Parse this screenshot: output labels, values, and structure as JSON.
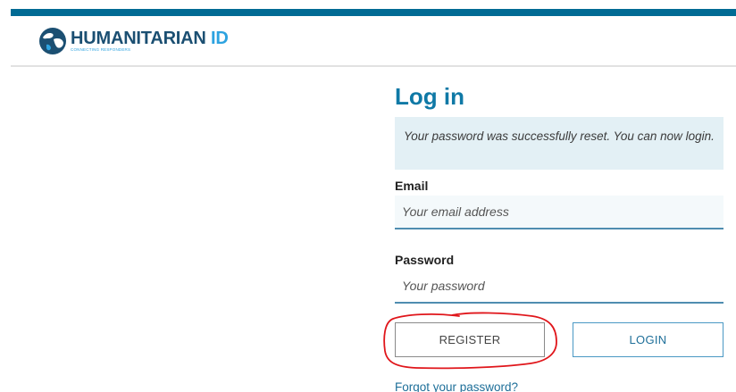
{
  "header": {
    "logo_title": "HUMANITARIAN",
    "logo_title_accent": "ID",
    "logo_tagline": "CONNECTING RESPONDERS",
    "brand_color": "#016b94"
  },
  "login": {
    "title": "Log in",
    "alert": "Your password was successfully reset. You can now login.",
    "email_label": "Email",
    "email_placeholder": "Your email address",
    "password_label": "Password",
    "password_placeholder": "Your password",
    "register_label": "REGISTER",
    "login_label": "LOGIN",
    "forgot_link": "Forgot your password?"
  },
  "annotation": {
    "shape": "hand-drawn circle around register button",
    "color": "#e0161b"
  }
}
